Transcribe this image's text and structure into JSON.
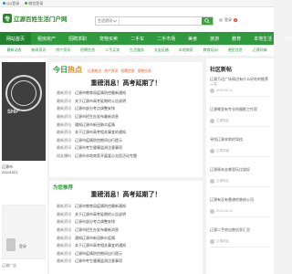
{
  "topbar": {
    "qq": "QQ登录",
    "wechat": "微信登录"
  },
  "header": {
    "logo_char": "专",
    "logo_text": "辽源百姓生活门户网",
    "search_category": "生活资讯",
    "search_placeholder": "",
    "user_label": "登录",
    "user_count": "0"
  },
  "nav": {
    "items": [
      "网站首页",
      "租房房产",
      "招聘求职",
      "宠物买卖",
      "二手车",
      "二手市场",
      "美食",
      "旅游",
      "教育",
      "本地生活",
      "通知公告"
    ],
    "active_index": 0
  },
  "subnav": {
    "items": [
      "最新动态",
      "新闻资讯",
      "房产资讯",
      "招聘信息",
      "二手买卖",
      "生活服务",
      "交友征婚",
      "本地商家",
      "教育培训",
      "便民信息",
      "辽源同城"
    ]
  },
  "left": {
    "stamp_code": "SHP",
    "caption_line1": "辽源市",
    "caption_line2": "41101021",
    "ad_button": "登录",
    "bottom_text": "辽源广告"
  },
  "today": {
    "title_main": "今日",
    "title_accent": "热点",
    "tags": [
      "辽源热点",
      "房产资讯",
      "招聘信息",
      "宠物交易"
    ],
    "headline": "重磅消息！高考延期了！",
    "news": [
      {
        "cat": "最新资讯",
        "title": "辽源市教育局疫情防控最新通知"
      },
      {
        "cat": "最新资讯",
        "title": "关于辽源市高考延期的公告说明"
      },
      {
        "cat": "最新资讯",
        "title": "辽源市部分考点调整安排"
      },
      {
        "cat": "最新资讯",
        "title": "辽源市招生办发布最新消息"
      },
      {
        "cat": "最新资讯",
        "title": "通知辽源市新冠肺炎疫情"
      },
      {
        "cat": "最新资讯",
        "title": "关于辽源市高考相关事宜的通知"
      },
      {
        "cat": "最新资讯",
        "title": "辽源市疫情防控期间出行提示"
      },
      {
        "cat": "最新资讯",
        "title": "辽源市考生健康监测注意事项"
      },
      {
        "cat": "网友爆料",
        "title": "辽源市本地商家开展爱心志愿活动专题"
      }
    ]
  },
  "recommend": {
    "title": "为您推荐",
    "headline": "重磅消息！高考延期了！",
    "news": [
      {
        "cat": "最新资讯",
        "title": "辽源市教育局疫情防控最新通知"
      },
      {
        "cat": "最新资讯",
        "title": "关于辽源市高考延期的公告说明"
      },
      {
        "cat": "最新资讯",
        "title": "辽源市部分考点调整安排"
      },
      {
        "cat": "最新资讯",
        "title": "辽源市招生办发布最新消息"
      },
      {
        "cat": "最新资讯",
        "title": "通知辽源市新冠肺炎疫情"
      },
      {
        "cat": "最新资讯",
        "title": "关于辽源市高考相关事宜的通知"
      },
      {
        "cat": "最新资讯",
        "title": "辽源市疫情防控期间出行提示"
      },
      {
        "cat": "最新资讯",
        "title": "辽源市考生健康监测注意事项"
      }
    ]
  },
  "right": {
    "title": "社区新帖",
    "posts": [
      {
        "text": "辽源万达广场周边有什么好吃的推荐一下"
      },
      {
        "text": "辽源哪里有专业的摄影工作室"
      },
      {
        "text": "寻找辽源本地的驾校"
      },
      {
        "text": "辽源周末去哪里玩比较好"
      },
      {
        "text": "辽源有没有靠谱的装修公司"
      },
      {
        "text": "辽源二手房出售信息汇总"
      }
    ],
    "meta": [
      "2020-09-12",
      "辽源网友",
      "辽源同城",
      "辽源网友",
      "2020-09-12",
      "辽源网友"
    ]
  }
}
